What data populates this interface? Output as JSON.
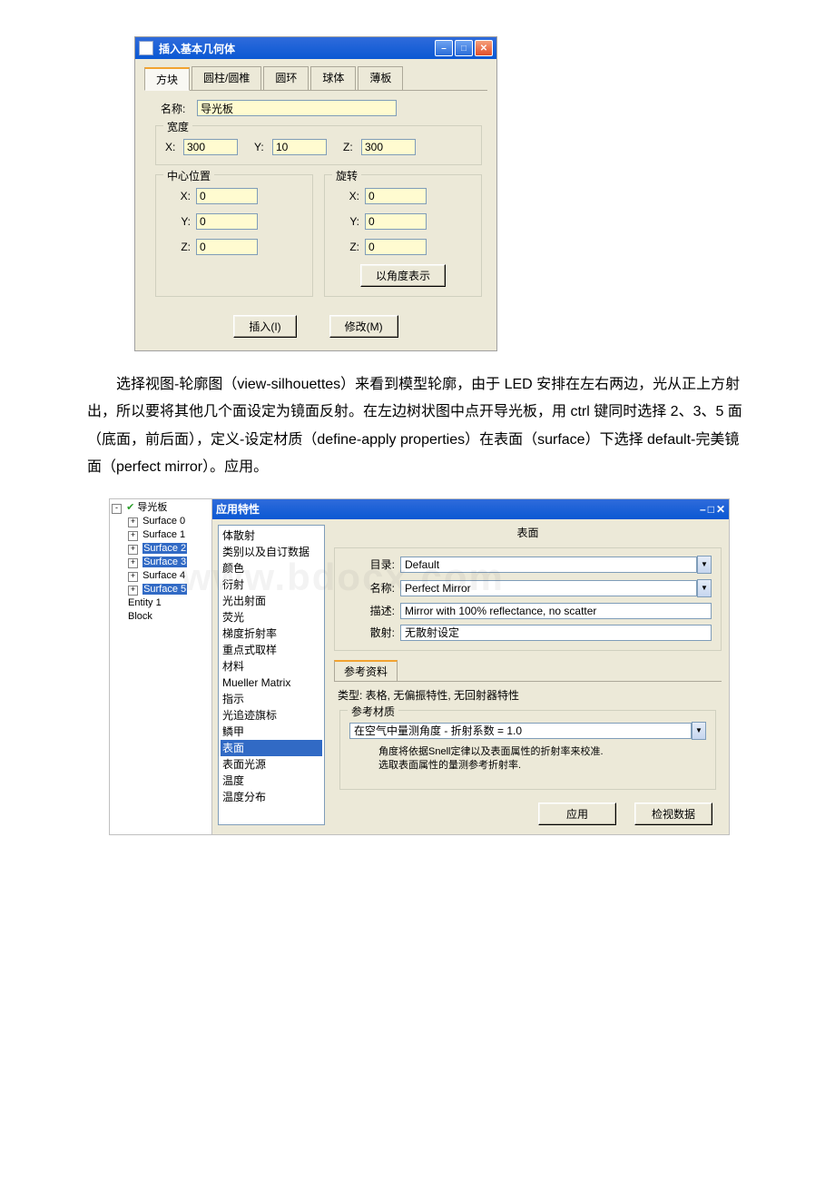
{
  "dialog1": {
    "title": "插入基本几何体",
    "tabs": [
      "方块",
      "圆柱/圆椎",
      "圆环",
      "球体",
      "薄板"
    ],
    "active_tab": "方块",
    "name_label": "名称:",
    "name_value": "导光板",
    "width_group": "宽度",
    "width": {
      "x_label": "X:",
      "x": "300",
      "y_label": "Y:",
      "y": "10",
      "z_label": "Z:",
      "z": "300"
    },
    "center_group": "中心位置",
    "center": {
      "x_label": "X:",
      "x": "0",
      "y_label": "Y:",
      "y": "0",
      "z_label": "Z:",
      "z": "0"
    },
    "rotate_group": "旋转",
    "rotate": {
      "x_label": "X:",
      "x": "0",
      "y_label": "Y:",
      "y": "0",
      "z_label": "Z:",
      "z": "0"
    },
    "angle_btn": "以角度表示",
    "insert_btn": "插入(I)",
    "modify_btn": "修改(M)"
  },
  "paragraph": "选择视图-轮廓图（view-silhouettes）来看到模型轮廓，由于 LED 安排在左右两边，光从正上方射出，所以要将其他几个面设定为镜面反射。在左边树状图中点开导光板，用 ctrl 键同时选择 2、3、5 面（底面，前后面），定义-设定材质（define-apply properties）在表面（surface）下选择 default-完美镜面（perfect mirror）。应用。",
  "tree": {
    "root": "导光板",
    "children": [
      "Surface 0",
      "Surface 1",
      "Surface 2",
      "Surface 3",
      "Surface 4",
      "Surface 5",
      "Entity 1",
      "Block"
    ],
    "selected": [
      "Surface 2",
      "Surface 3",
      "Surface 5"
    ]
  },
  "dialog2": {
    "title": "应用特性",
    "categories": [
      "体散射",
      "类别以及自订数据",
      "颜色",
      "衍射",
      "光出射面",
      "荧光",
      "梯度折射率",
      "重点式取样",
      "材料",
      "Mueller Matrix",
      "指示",
      "光追迹旗标",
      "鳞甲",
      "表面",
      "表面光源",
      "温度",
      "温度分布"
    ],
    "selected_category": "表面",
    "panel_title": "表面",
    "catalog_label": "目录:",
    "catalog_value": "Default",
    "name_label": "名称:",
    "name_value": "Perfect Mirror",
    "desc_label": "描述:",
    "desc_value": "Mirror with 100% reflectance, no scatter",
    "scatter_label": "散射:",
    "scatter_value": "无散射设定",
    "ref_tab": "参考资料",
    "ref_type": "类型: 表格,  无偏振特性,  无回射器特性",
    "ref_material_group": "参考材质",
    "ref_combo": "在空气中量测角度 - 折射系数 = 1.0",
    "ref_note1": "角度将依据Snell定律以及表面属性的折射率来校准.",
    "ref_note2": "选取表面属性的量测参考折射率.",
    "apply_btn": "应用",
    "view_btn": "检视数据"
  },
  "watermark": "www.bdocx.com"
}
